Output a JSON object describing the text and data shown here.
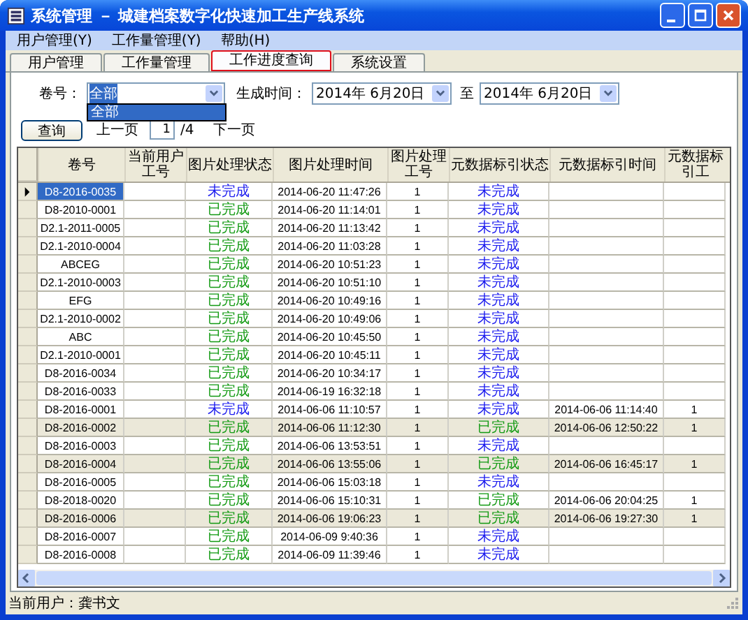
{
  "window": {
    "title": "系统管理 － 城建档案数字化快速加工生产线系统"
  },
  "menu": [
    "用户管理(Y)",
    "工作量管理(Y)",
    "帮助(H)"
  ],
  "tabs": [
    {
      "label": "用户管理",
      "selected": false
    },
    {
      "label": "工作量管理",
      "selected": false
    },
    {
      "label": "工作进度查询",
      "selected": true
    },
    {
      "label": "系统设置",
      "selected": false
    }
  ],
  "filter": {
    "volume_label": "卷号：",
    "volume_value": "全部",
    "volume_options": [
      {
        "label": "全部",
        "selected": true
      }
    ],
    "date_label": "生成时间：",
    "date_from": "2014年 6月20日",
    "date_sep": "至",
    "date_to": "2014年 6月20日"
  },
  "pager": {
    "query_button": "查询",
    "prev": "上一页",
    "page": "1",
    "total": "/4",
    "next": "下一页"
  },
  "table": {
    "columns": [
      "卷号",
      "当前用户工号",
      "图片处理状态",
      "图片处理时间",
      "图片处理工号",
      "元数据标引状态",
      "元数据标引时间",
      "元数据标引工"
    ],
    "rows": [
      {
        "volume": "D8-2016-0035",
        "img_status": {
          "text": "未完成",
          "done": false
        },
        "img_time": "2014-06-20 11:47:26",
        "img_worker": "1",
        "meta_status": {
          "text": "未完成",
          "done": false
        },
        "selected": true,
        "highlighted": false
      },
      {
        "volume": "D8-2010-0001",
        "img_status": {
          "text": "已完成",
          "done": true
        },
        "img_time": "2014-06-20 11:14:01",
        "img_worker": "1",
        "meta_status": {
          "text": "未完成",
          "done": false
        },
        "selected": false,
        "highlighted": false
      },
      {
        "volume": "D2.1-2011-0005",
        "img_status": {
          "text": "已完成",
          "done": true
        },
        "img_time": "2014-06-20 11:13:42",
        "img_worker": "1",
        "meta_status": {
          "text": "未完成",
          "done": false
        },
        "selected": false,
        "highlighted": false
      },
      {
        "volume": "D2.1-2010-0004",
        "img_status": {
          "text": "已完成",
          "done": true
        },
        "img_time": "2014-06-20 11:03:28",
        "img_worker": "1",
        "meta_status": {
          "text": "未完成",
          "done": false
        },
        "selected": false,
        "highlighted": false
      },
      {
        "volume": "ABCEG",
        "img_status": {
          "text": "已完成",
          "done": true
        },
        "img_time": "2014-06-20 10:51:23",
        "img_worker": "1",
        "meta_status": {
          "text": "未完成",
          "done": false
        },
        "selected": false,
        "highlighted": false
      },
      {
        "volume": "D2.1-2010-0003",
        "img_status": {
          "text": "已完成",
          "done": true
        },
        "img_time": "2014-06-20 10:51:10",
        "img_worker": "1",
        "meta_status": {
          "text": "未完成",
          "done": false
        },
        "selected": false,
        "highlighted": false
      },
      {
        "volume": "EFG",
        "img_status": {
          "text": "已完成",
          "done": true
        },
        "img_time": "2014-06-20 10:49:16",
        "img_worker": "1",
        "meta_status": {
          "text": "未完成",
          "done": false
        },
        "selected": false,
        "highlighted": false
      },
      {
        "volume": "D2.1-2010-0002",
        "img_status": {
          "text": "已完成",
          "done": true
        },
        "img_time": "2014-06-20 10:49:06",
        "img_worker": "1",
        "meta_status": {
          "text": "未完成",
          "done": false
        },
        "selected": false,
        "highlighted": false
      },
      {
        "volume": "ABC",
        "img_status": {
          "text": "已完成",
          "done": true
        },
        "img_time": "2014-06-20 10:45:50",
        "img_worker": "1",
        "meta_status": {
          "text": "未完成",
          "done": false
        },
        "selected": false,
        "highlighted": false
      },
      {
        "volume": "D2.1-2010-0001",
        "img_status": {
          "text": "已完成",
          "done": true
        },
        "img_time": "2014-06-20 10:45:11",
        "img_worker": "1",
        "meta_status": {
          "text": "未完成",
          "done": false
        },
        "selected": false,
        "highlighted": false
      },
      {
        "volume": "D8-2016-0034",
        "img_status": {
          "text": "已完成",
          "done": true
        },
        "img_time": "2014-06-20 10:34:17",
        "img_worker": "1",
        "meta_status": {
          "text": "未完成",
          "done": false
        },
        "selected": false,
        "highlighted": false
      },
      {
        "volume": "D8-2016-0033",
        "img_status": {
          "text": "已完成",
          "done": true
        },
        "img_time": "2014-06-19 16:32:18",
        "img_worker": "1",
        "meta_status": {
          "text": "未完成",
          "done": false
        },
        "selected": false,
        "highlighted": false
      },
      {
        "volume": "D8-2016-0001",
        "img_status": {
          "text": "未完成",
          "done": false
        },
        "img_time": "2014-06-06 11:10:57",
        "img_worker": "1",
        "meta_status": {
          "text": "未完成",
          "done": false
        },
        "meta_time": "2014-06-06 11:14:40",
        "meta_worker": "1",
        "selected": false,
        "highlighted": false
      },
      {
        "volume": "D8-2016-0002",
        "img_status": {
          "text": "已完成",
          "done": true
        },
        "img_time": "2014-06-06 11:12:30",
        "img_worker": "1",
        "meta_status": {
          "text": "已完成",
          "done": true
        },
        "meta_time": "2014-06-06 12:50:22",
        "meta_worker": "1",
        "selected": false,
        "highlighted": true
      },
      {
        "volume": "D8-2016-0003",
        "img_status": {
          "text": "已完成",
          "done": true
        },
        "img_time": "2014-06-06 13:53:51",
        "img_worker": "1",
        "meta_status": {
          "text": "未完成",
          "done": false
        },
        "selected": false,
        "highlighted": false
      },
      {
        "volume": "D8-2016-0004",
        "img_status": {
          "text": "已完成",
          "done": true
        },
        "img_time": "2014-06-06 13:55:06",
        "img_worker": "1",
        "meta_status": {
          "text": "已完成",
          "done": true
        },
        "meta_time": "2014-06-06 16:45:17",
        "meta_worker": "1",
        "selected": false,
        "highlighted": true
      },
      {
        "volume": "D8-2016-0005",
        "img_status": {
          "text": "已完成",
          "done": true
        },
        "img_time": "2014-06-06 15:03:18",
        "img_worker": "1",
        "meta_status": {
          "text": "未完成",
          "done": false
        },
        "selected": false,
        "highlighted": false
      },
      {
        "volume": "D8-2018-0020",
        "img_status": {
          "text": "已完成",
          "done": true
        },
        "img_time": "2014-06-06 15:10:31",
        "img_worker": "1",
        "meta_status": {
          "text": "已完成",
          "done": true
        },
        "meta_time": "2014-06-06 20:04:25",
        "meta_worker": "1",
        "selected": false,
        "highlighted": false
      },
      {
        "volume": "D8-2016-0006",
        "img_status": {
          "text": "已完成",
          "done": true
        },
        "img_time": "2014-06-06 19:06:23",
        "img_worker": "1",
        "meta_status": {
          "text": "已完成",
          "done": true
        },
        "meta_time": "2014-06-06 19:27:30",
        "meta_worker": "1",
        "selected": false,
        "highlighted": true
      },
      {
        "volume": "D8-2016-0007",
        "img_status": {
          "text": "已完成",
          "done": true
        },
        "img_time": "2014-06-09 9:40:36",
        "img_worker": "1",
        "meta_status": {
          "text": "未完成",
          "done": false
        },
        "selected": false,
        "highlighted": false
      },
      {
        "volume": "D8-2016-0008",
        "img_status": {
          "text": "已完成",
          "done": true
        },
        "img_time": "2014-06-09 11:39:46",
        "img_worker": "1",
        "meta_status": {
          "text": "未完成",
          "done": false
        },
        "selected": false,
        "highlighted": false
      }
    ]
  },
  "status_bar": "当前用户：龚书文"
}
